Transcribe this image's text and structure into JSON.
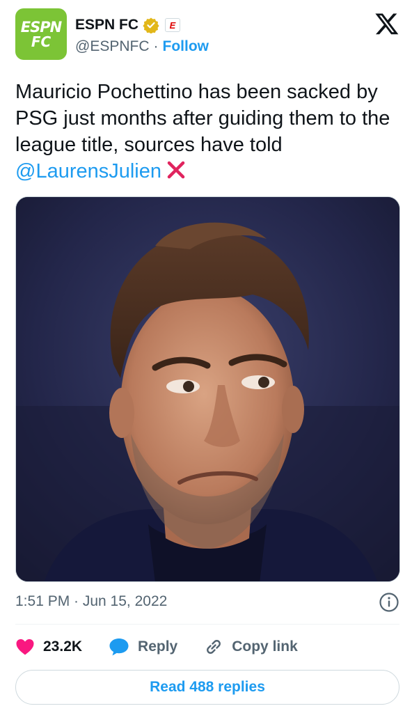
{
  "account": {
    "avatar_text_line1": "ESPN",
    "avatar_text_line2": "FC",
    "name": "ESPN FC",
    "affiliate_badge": "E",
    "handle": "@ESPNFC",
    "separator": "·",
    "follow_label": "Follow"
  },
  "tweet": {
    "text": "Mauricio Pochettino has been sacked by PSG just months after guiding them to the league title, sources have told ",
    "mention": "@LaurensJulien",
    "emoji": "cross-mark-icon",
    "timestamp": "1:51 PM · Jun 15, 2022"
  },
  "media": {
    "description_icon": "photo"
  },
  "actions": {
    "likes_count": "23.2K",
    "reply_label": "Reply",
    "copy_link_label": "Copy link"
  },
  "footer": {
    "read_replies_label": "Read 488 replies"
  },
  "colors": {
    "accent": "#1d9bf0",
    "brand": "#7cc436",
    "like": "#f91880",
    "verified": "#e2b719"
  }
}
